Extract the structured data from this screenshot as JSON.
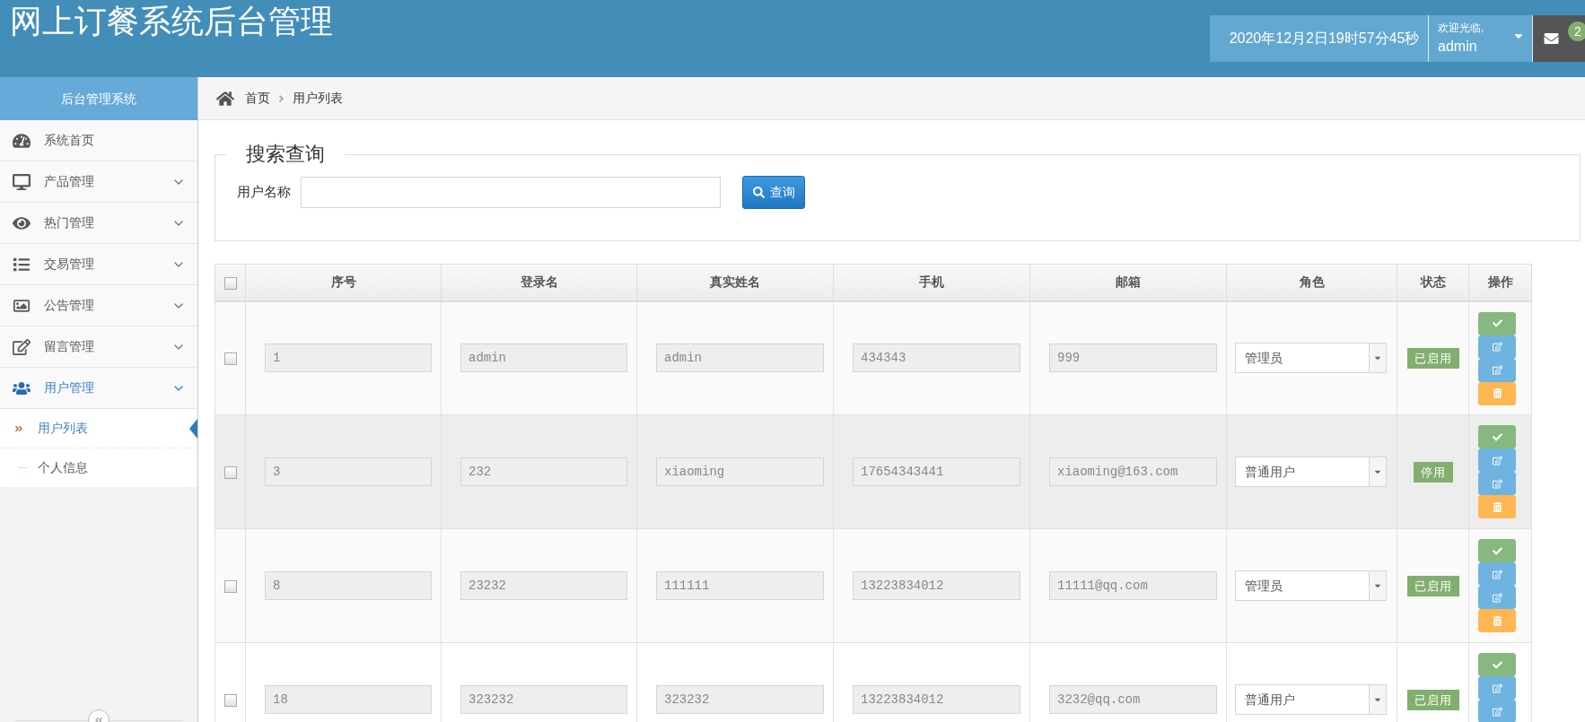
{
  "header": {
    "title": "网上订餐系统后台管理",
    "datetime": "2020年12月2日19时57分45秒",
    "greeting": "欢迎光临,",
    "username": "admin",
    "message_count": "2"
  },
  "sidebar": {
    "title": "后台管理系统",
    "items": [
      {
        "label": "系统首页",
        "kind": "link",
        "expanded": false
      },
      {
        "label": "产品管理",
        "kind": "group",
        "expanded": false
      },
      {
        "label": "热门管理",
        "kind": "group",
        "expanded": false
      },
      {
        "label": "交易管理",
        "kind": "group",
        "expanded": false
      },
      {
        "label": "公告管理",
        "kind": "group",
        "expanded": false
      },
      {
        "label": "留言管理",
        "kind": "group",
        "expanded": false
      },
      {
        "label": "用户管理",
        "kind": "group",
        "expanded": true,
        "children": [
          {
            "label": "用户列表",
            "selected": true
          },
          {
            "label": "个人信息",
            "selected": false
          }
        ]
      }
    ]
  },
  "breadcrumb": [
    {
      "label": "首页"
    },
    {
      "label": "用户列表"
    }
  ],
  "search": {
    "legend": "搜索查询",
    "label": "用户名称",
    "button": "查询"
  },
  "table": {
    "all_checked": false,
    "columns": [
      "序号",
      "登录名",
      "真实姓名",
      "手机",
      "邮箱",
      "角色",
      "状态",
      "操作"
    ],
    "rows": [
      {
        "checked": false,
        "hovered": false,
        "id": "1",
        "login": "admin",
        "real_name": "admin",
        "phone": "434343",
        "email": "999",
        "role": "管理员",
        "status": "已启用",
        "actions": [
          {
            "kind": "approve"
          },
          {
            "kind": "edit"
          },
          {
            "kind": "edit"
          },
          {
            "kind": "delete"
          }
        ]
      },
      {
        "checked": false,
        "hovered": true,
        "id": "3",
        "login": "232",
        "real_name": "xiaoming",
        "phone": "17654343441",
        "email": "xiaoming@163.com",
        "role": "普通用户",
        "status": "停用",
        "actions": [
          {
            "kind": "approve"
          },
          {
            "kind": "edit"
          },
          {
            "kind": "edit"
          },
          {
            "kind": "delete"
          }
        ]
      },
      {
        "checked": false,
        "hovered": false,
        "id": "8",
        "login": "23232",
        "real_name": "111111",
        "phone": "13223834012",
        "email": "11111@qq.com",
        "role": "管理员",
        "status": "已启用",
        "actions": [
          {
            "kind": "approve"
          },
          {
            "kind": "edit"
          },
          {
            "kind": "edit"
          },
          {
            "kind": "delete"
          }
        ]
      },
      {
        "checked": false,
        "hovered": false,
        "id": "18",
        "login": "323232",
        "real_name": "323232",
        "phone": "13223834012",
        "email": "3232@qq.com",
        "role": "普通用户",
        "status": "已启用",
        "actions": [
          {
            "kind": "approve"
          },
          {
            "kind": "edit"
          },
          {
            "kind": "edit"
          }
        ]
      }
    ]
  }
}
